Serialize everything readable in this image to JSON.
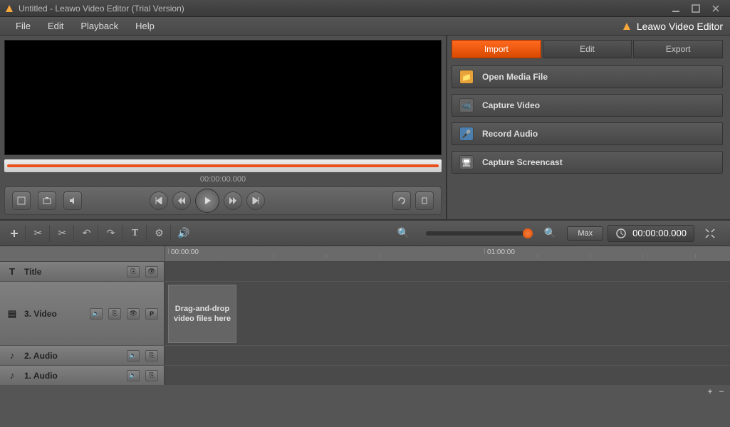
{
  "window": {
    "title": "Untitled - Leawo Video Editor (Trial Version)"
  },
  "menu": {
    "file": "File",
    "edit": "Edit",
    "playback": "Playback",
    "help": "Help"
  },
  "brand": "Leawo Video Editor",
  "preview": {
    "timecode": "00:00:00.000"
  },
  "tabs": {
    "import": "Import",
    "edit": "Edit",
    "export": "Export"
  },
  "import_options": {
    "open_media": "Open Media File",
    "capture_video": "Capture Video",
    "record_audio": "Record Audio",
    "capture_screencast": "Capture Screencast"
  },
  "toolbar2": {
    "max": "Max",
    "time": "00:00:00.000"
  },
  "ruler": {
    "start": "00:00:00",
    "mark2": "01:00:00"
  },
  "tracks": {
    "title": "Title",
    "video": "3. Video",
    "audio2": "2. Audio",
    "audio1": "1. Audio"
  },
  "dropzone": "Drag-and-drop video files here"
}
